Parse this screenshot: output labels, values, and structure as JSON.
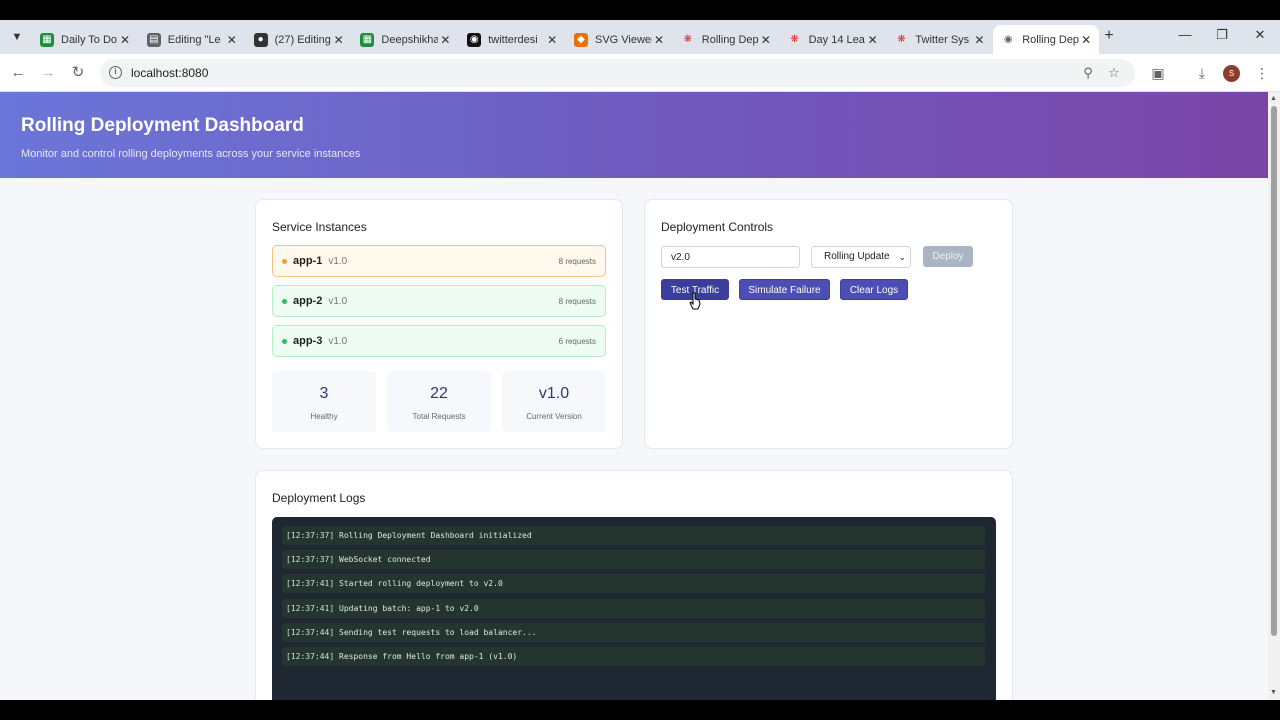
{
  "browser": {
    "tabs": [
      {
        "title": "Daily To Do",
        "favicon_color": "#1e8e3e",
        "favicon": "sheets-icon"
      },
      {
        "title": "Editing \"Le",
        "favicon_color": "#5f6368",
        "favicon": "doc-icon"
      },
      {
        "title": "(27) Editing",
        "favicon_color": "#333333",
        "favicon": "profile-icon"
      },
      {
        "title": "Deepshikha",
        "favicon_color": "#1e8e3e",
        "favicon": "sheets-icon"
      },
      {
        "title": "twitterdesi",
        "favicon_color": "#111111",
        "favicon": "github-icon"
      },
      {
        "title": "SVG Viewer",
        "favicon_color": "#e8710a",
        "favicon": "svg-icon"
      },
      {
        "title": "Rolling Dep",
        "favicon_color": "#d93025",
        "favicon": "claude-icon"
      },
      {
        "title": "Day 14 Lea",
        "favicon_color": "#d93025",
        "favicon": "claude-icon"
      },
      {
        "title": "Twitter Sys",
        "favicon_color": "#d93025",
        "favicon": "claude-icon"
      },
      {
        "title": "Rolling Dep",
        "favicon_color": "#5f6368",
        "favicon": "globe-icon"
      }
    ],
    "url": "localhost:8080",
    "avatar_letter": "S"
  },
  "header": {
    "title": "Rolling Deployment Dashboard",
    "subtitle": "Monitor and control rolling deployments across your service instances"
  },
  "instances": {
    "title": "Service Instances",
    "items": [
      {
        "name": "app-1",
        "version": "v1.0",
        "requests": "8 requests",
        "status": "updating"
      },
      {
        "name": "app-2",
        "version": "v1.0",
        "requests": "8 requests",
        "status": "healthy"
      },
      {
        "name": "app-3",
        "version": "v1.0",
        "requests": "6 requests",
        "status": "healthy"
      }
    ],
    "stats": [
      {
        "value": "3",
        "label": "Healthy"
      },
      {
        "value": "22",
        "label": "Total Requests"
      },
      {
        "value": "v1.0",
        "label": "Current Version"
      }
    ]
  },
  "controls": {
    "title": "Deployment Controls",
    "version_value": "v2.0",
    "strategy": "Rolling Update",
    "deploy_label": "Deploy",
    "test_traffic_label": "Test Traffic",
    "simulate_failure_label": "Simulate Failure",
    "clear_logs_label": "Clear Logs"
  },
  "logs": {
    "title": "Deployment Logs",
    "entries": [
      {
        "time": "[12:37:37]",
        "message": "Rolling Deployment Dashboard initialized"
      },
      {
        "time": "[12:37:37]",
        "message": "WebSocket connected"
      },
      {
        "time": "[12:37:41]",
        "message": "Started rolling deployment to v2.0"
      },
      {
        "time": "[12:37:41]",
        "message": "Updating batch: app-1 to v2.0"
      },
      {
        "time": "[12:37:44]",
        "message": "Sending test requests to load balancer..."
      },
      {
        "time": "[12:37:44]",
        "message": "Response from Hello from app-1 (v1.0)"
      }
    ]
  },
  "colors": {
    "header_gradient_start": "#6b76d8",
    "header_gradient_end": "#7a45a7",
    "primary_button": "#4c4eb3",
    "healthy": "#2bbd5f",
    "updating": "#e2a33b"
  }
}
